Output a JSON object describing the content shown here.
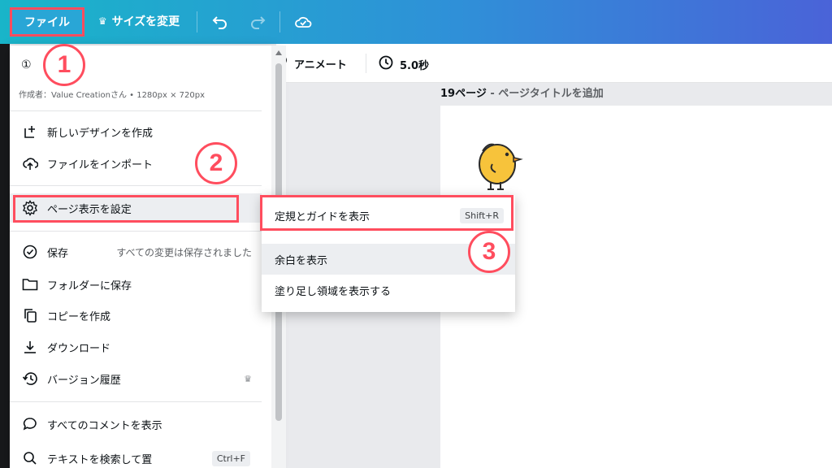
{
  "topbar": {
    "file_label": "ファイル",
    "resize_label": "サイズを変更",
    "resize_icon": "crown-icon",
    "undo_icon": "undo-icon",
    "redo_icon": "redo-icon",
    "save_status_icon": "cloud-check-icon"
  },
  "editor_toolbar": {
    "animate_label": "アニメート",
    "duration_label": "5.0秒"
  },
  "page": {
    "number_label": "19ページ",
    "separator": " - ",
    "title_placeholder": "ページタイトルを追加"
  },
  "file_menu": {
    "doc_title": "①",
    "doc_meta": "作成者：Value Creationさん • 1280px × 720px",
    "items": [
      {
        "label": "新しいデザインを作成",
        "icon": "plus-square-icon"
      },
      {
        "label": "ファイルをインポート",
        "icon": "cloud-upload-icon"
      },
      {
        "label": "ページ表示を設定",
        "icon": "gear-icon"
      },
      {
        "label": "保存",
        "icon": "check-circle-icon",
        "extra": "すべての変更は保存されました"
      },
      {
        "label": "フォルダーに保存",
        "icon": "folder-icon"
      },
      {
        "label": "コピーを作成",
        "icon": "copy-icon"
      },
      {
        "label": "ダウンロード",
        "icon": "download-icon"
      },
      {
        "label": "バージョン履歴",
        "icon": "history-icon"
      },
      {
        "label": "すべてのコメントを表示",
        "icon": "comment-icon"
      },
      {
        "label": "テキストを検索して置",
        "icon": "search-icon",
        "shortcut": "Ctrl+F"
      }
    ]
  },
  "view_submenu": {
    "items": [
      {
        "label": "定規とガイドを表示",
        "shortcut": "Shift+R"
      },
      {
        "label": "余白を表示"
      },
      {
        "label": "塗り足し領域を表示する"
      }
    ]
  },
  "annotations": [
    "1",
    "2",
    "3"
  ],
  "colors": {
    "accent_red": "#ff4d5e",
    "topbar_start": "#19b5c9",
    "topbar_end": "#4a63d8"
  }
}
